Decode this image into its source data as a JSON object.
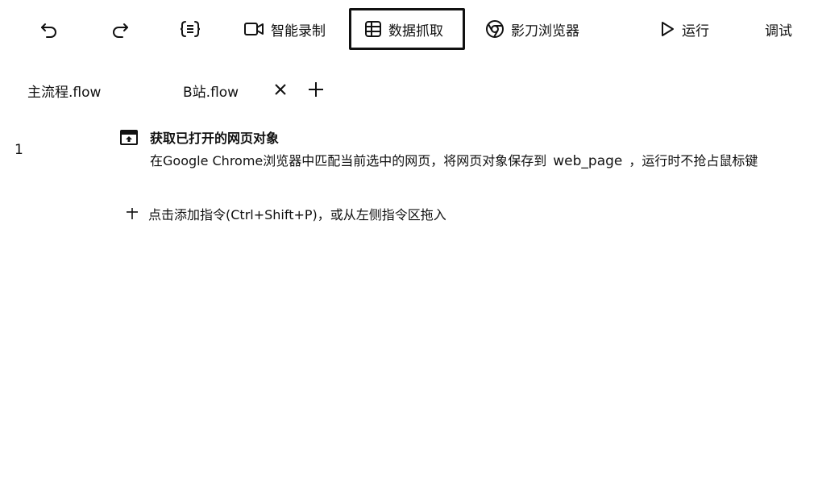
{
  "toolbar": {
    "undo_icon": "undo-icon",
    "redo_icon": "redo-icon",
    "variables_icon": "braces-icon",
    "record_label": "智能录制",
    "scrape_label": "数据抓取",
    "browser_label": "影刀浏览器",
    "run_label": "运行",
    "debug_label": "调试"
  },
  "tabs": {
    "items": [
      {
        "label": "主流程.flow"
      },
      {
        "label": "B站.flow"
      }
    ],
    "close_icon": "close-icon",
    "add_icon": "plus-icon"
  },
  "editor": {
    "line_number": "1",
    "command": {
      "icon": "browser-window-icon",
      "title": "获取已打开的网页对象",
      "desc_prefix": "在Google Chrome浏览器中匹配当前选中的网页，将网页对象保存到",
      "variable": "web_page",
      "desc_suffix": "，运行时不抢占鼠标键"
    },
    "add_command": {
      "icon": "plus-icon",
      "label": "点击添加指令(Ctrl+Shift+P)，或从左侧指令区拖入"
    }
  }
}
